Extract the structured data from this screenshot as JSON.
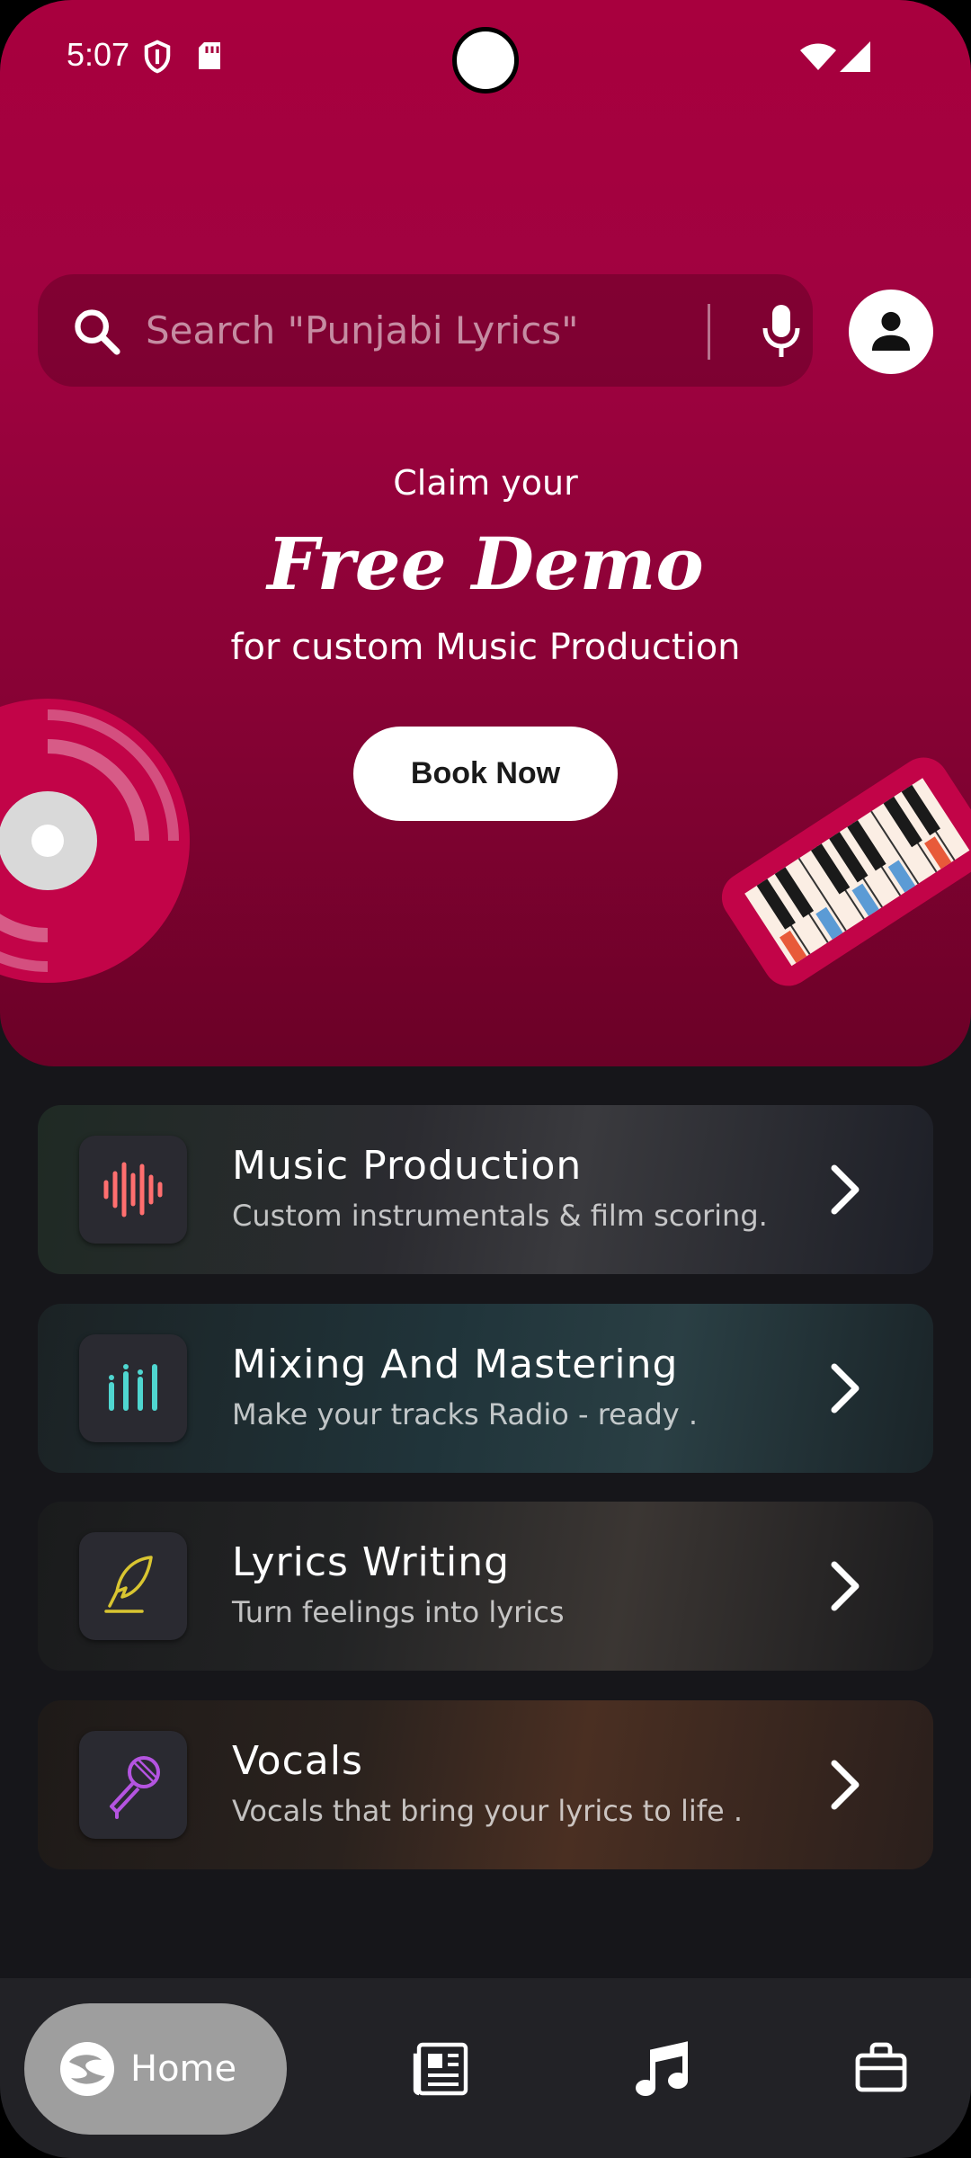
{
  "status_bar": {
    "time": "5:07"
  },
  "search": {
    "placeholder": "Search \"Punjabi Lyrics\""
  },
  "promo": {
    "claim_text": "Claim your",
    "title": "Free Demo",
    "subtitle": "for custom Music Production",
    "button_label": "Book Now"
  },
  "services": [
    {
      "title": "Music Production",
      "description": "Custom instrumentals & film scoring.",
      "icon": "waveform-icon",
      "icon_color": "#ff6f6f"
    },
    {
      "title": "Mixing And Mastering",
      "description": "Make your tracks Radio - ready .",
      "icon": "equalizer-icon",
      "icon_color": "#4fd6d0"
    },
    {
      "title": "Lyrics Writing",
      "description": "Turn feelings into lyrics",
      "icon": "quill-icon",
      "icon_color": "#d9c531"
    },
    {
      "title": "Vocals",
      "description": "Vocals that bring your lyrics to life .",
      "icon": "microphone-icon",
      "icon_color": "#b454e0"
    }
  ],
  "bottom_nav": {
    "items": [
      {
        "label": "Home",
        "icon": "home-logo-icon",
        "active": true
      },
      {
        "label": "",
        "icon": "news-icon",
        "active": false
      },
      {
        "label": "",
        "icon": "music-note-icon",
        "active": false
      },
      {
        "label": "",
        "icon": "briefcase-icon",
        "active": false
      }
    ]
  },
  "colors": {
    "hero_top": "#a8003e",
    "hero_bottom": "#6b0127",
    "background": "#16161a",
    "nav_active": "#9e9e9e"
  }
}
